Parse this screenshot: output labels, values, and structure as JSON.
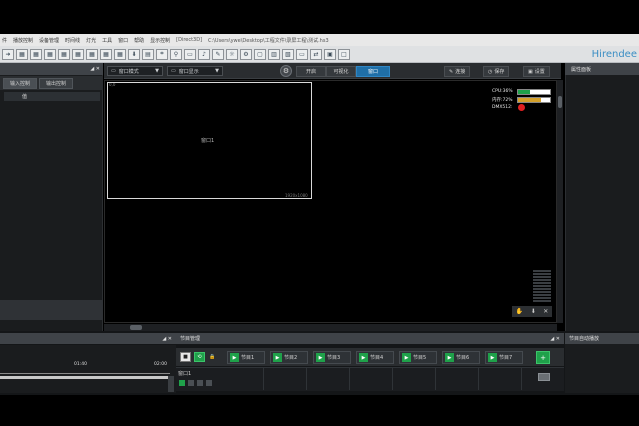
{
  "menubar": {
    "items": [
      "件",
      "播放控制",
      "设备管理",
      "时间线",
      "灯光",
      "工具",
      "窗口",
      "帮助",
      "显示控制"
    ],
    "renderer": "[Direct3D]",
    "file_path": "C:\\Users\\ywe\\Desktop\\工程文件\\录屏工程\\测试.hs3"
  },
  "brand": "Hirendee",
  "left_panel": {
    "title": "",
    "tabs": [
      "输入控制",
      "输出控制"
    ],
    "row_label": "值"
  },
  "center": {
    "output_mode": "窗口模式",
    "display_mode": "窗口显示",
    "segments": [
      "开启",
      "可视化",
      "窗口"
    ],
    "actions": [
      "连接",
      "保存",
      "设置"
    ],
    "preview_label": "窗口1",
    "preview_corner": "1920x1080",
    "canvas_corner": "0,0"
  },
  "meters": {
    "cpu_label": "CPU:36%",
    "cpu_value": 0.36,
    "mem_label": "内存:72%",
    "mem_value": 0.72,
    "dmx_label": "DMX512:"
  },
  "right_panel": {
    "title": "属性面板"
  },
  "bottom": {
    "timeline_ticks": [
      "01:40",
      "02:00"
    ],
    "program_title": "节目管理",
    "right_title": "节目自动播放",
    "programs": [
      "节目1",
      "节目2",
      "节目3",
      "节目4",
      "节目5",
      "节目6",
      "节目7"
    ],
    "layer_label": "窗口1"
  },
  "colors": {
    "accent_blue": "#1f6fa8",
    "play_green": "#1fa14a",
    "cpu_green": "#1fa14a",
    "mem_yellow": "#d4a02a",
    "dmx_red": "#e02020"
  }
}
